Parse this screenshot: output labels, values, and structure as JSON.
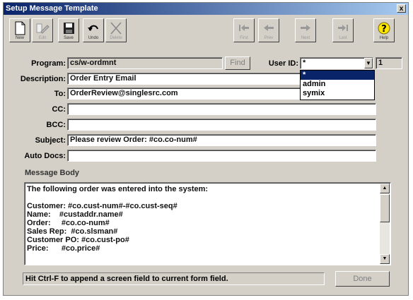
{
  "window": {
    "title": "Setup Message Template",
    "close_label": "x"
  },
  "toolbar": [
    {
      "name": "new",
      "label": "New",
      "icon": "document-icon",
      "enabled": true
    },
    {
      "name": "edit",
      "label": "Edit",
      "icon": "edit-icon",
      "enabled": false
    },
    {
      "name": "save",
      "label": "Save",
      "icon": "floppy-icon",
      "enabled": true
    },
    {
      "name": "undo",
      "label": "Undo",
      "icon": "undo-icon",
      "enabled": true
    },
    {
      "name": "delete",
      "label": "Delete",
      "icon": "delete-icon",
      "enabled": false
    },
    {
      "name": "first",
      "label": "First",
      "icon": "first-icon",
      "enabled": false
    },
    {
      "name": "prev",
      "label": "Prev",
      "icon": "prev-icon",
      "enabled": false
    },
    {
      "name": "next",
      "label": "Next",
      "icon": "next-icon",
      "enabled": false
    },
    {
      "name": "last",
      "label": "Last",
      "icon": "last-icon",
      "enabled": false
    },
    {
      "name": "help",
      "label": "Help",
      "icon": "help-icon",
      "enabled": true
    }
  ],
  "form": {
    "program_label": "Program:",
    "program_value": "cs/w-ordmnt",
    "find_label": "Find",
    "userid_label": "User ID:",
    "userid_value": "*",
    "userid_count": "1",
    "userid_options": [
      "*",
      "admin",
      "symix"
    ],
    "description_label": "Description:",
    "description_value": "Order Entry Email",
    "to_label": "To:",
    "to_value": "OrderReview@singlesrc.com",
    "cc_label": "CC:",
    "cc_value": "",
    "bcc_label": "BCC:",
    "bcc_value": "",
    "subject_label": "Subject:",
    "subject_value": "Please review Order: #co.co-num#",
    "autodocs_label": "Auto Docs:",
    "autodocs_value": ""
  },
  "message_body": {
    "label": "Message Body",
    "lines": [
      "The following order was entered into the system:",
      "",
      "Customer: #co.cust-num#-#co.cust-seq#",
      "Name:    #custaddr.name#",
      "Order:     #co.co-num#",
      "Sales Rep:  #co.slsman#",
      "Customer PO: #co.cust-po#",
      "Price:      #co.price#"
    ]
  },
  "status_text": "Hit Ctrl-F to append a screen field to current form field.",
  "done_label": "Done"
}
